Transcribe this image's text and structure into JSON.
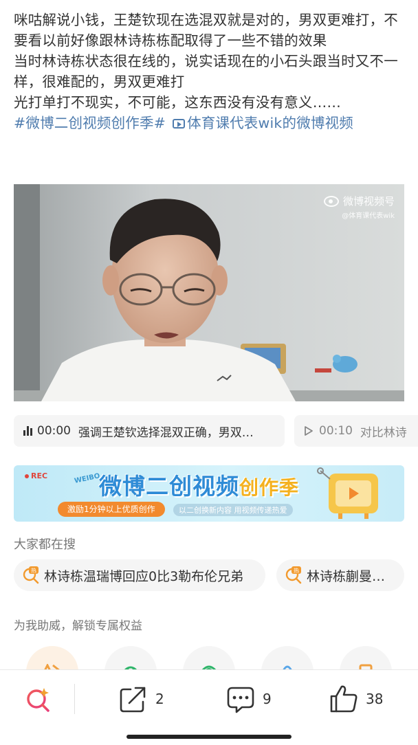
{
  "post": {
    "paragraphs": [
      "咪咕解说小钱，王楚钦现在选混双就是对的，男双更难打，不要看以前好像跟林诗栋栋配取得了一些不错的效果",
      "当时林诗栋状态很在线的，说实话现在的小石头跟当时又不一样，很难配的，男双更难打",
      "光打单打不现实，不可能，这东西没有没有意义……"
    ],
    "hashtag": "#微博二创视频创作季#",
    "video_link": "体育课代表wik的微博视频"
  },
  "video": {
    "watermark_title": "微博视频号",
    "watermark_account": "@体育课代表wik"
  },
  "chapters": [
    {
      "time": "00:00",
      "text": "强调王楚钦选择混双正确，男双…",
      "icon": "audio-bars-icon"
    },
    {
      "time": "00:10",
      "text": "对比林诗",
      "icon": "play-outline-icon"
    }
  ],
  "banner": {
    "rec_label": "REC",
    "weibo_tag": "WEIBO",
    "title_main": "微博二创视频",
    "title_accent": "创作季",
    "pill_text": "激励1分钟以上优质创作",
    "subtitle": "以二创换新内容 用视频传递热爱"
  },
  "search_section": {
    "title": "大家都在搜",
    "items": [
      {
        "text": "林诗栋温瑞博回应0比3勒布伦兄弟",
        "icon": "hot-search-icon"
      },
      {
        "text": "林诗栋蒯曼…",
        "icon": "hot-search-icon"
      }
    ]
  },
  "cheer_section": {
    "title": "为我助威，解锁专属权益"
  },
  "bottom_bar": {
    "repost_count": "2",
    "comment_count": "9",
    "like_count": "38"
  },
  "colors": {
    "link": "#4f7cae",
    "banner_blue": "#2e8bd6",
    "banner_orange": "#f28a2e",
    "hot_orange": "#f29a2e"
  }
}
